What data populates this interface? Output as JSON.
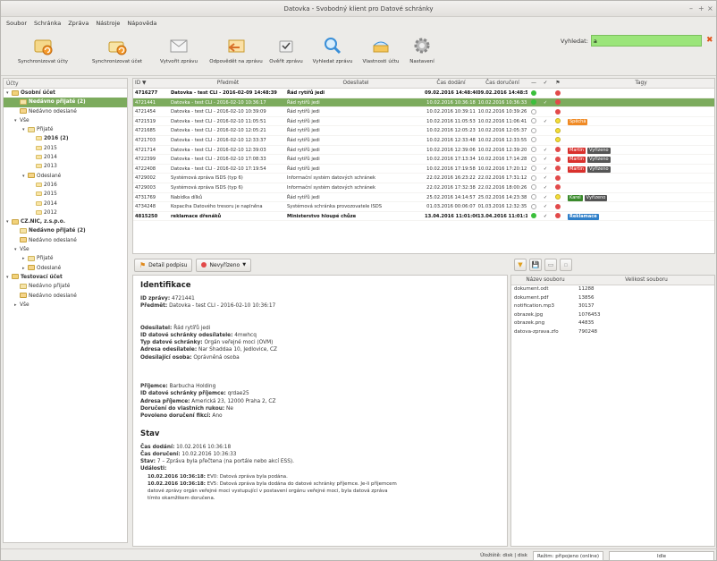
{
  "window": {
    "title": "Datovka - Svobodný klient pro Datové schránky",
    "controls": [
      "–",
      "+",
      "×"
    ]
  },
  "menu": [
    "Soubor",
    "Schránka",
    "Zpráva",
    "Nástroje",
    "Nápověda"
  ],
  "toolbar": {
    "buttons": [
      "Synchronizovat účty",
      "Synchronizovat účet",
      "Vytvořit zprávu",
      "Odpovědět na zprávu",
      "Ověřit zprávu",
      "Vyhledat zprávu",
      "Vlastnosti účtu",
      "Nastavení"
    ],
    "search_label": "Vyhledat:",
    "search_value": "a"
  },
  "colors": {
    "accent_green": "#7cab5d",
    "search_bg": "#9be57a"
  },
  "tree": {
    "header": "Účty",
    "rows": [
      {
        "label": "Osobní účet",
        "level": 0,
        "expander": "▾",
        "icon": "acc",
        "bold": true
      },
      {
        "label": "Nedávno přijaté (2)",
        "level": 1,
        "icon": "inbox",
        "bold": true,
        "selected": true
      },
      {
        "label": "Nedávno odeslané",
        "level": 1,
        "icon": "outbox"
      },
      {
        "label": "Vše",
        "level": 1,
        "expander": "▾"
      },
      {
        "label": "Přijaté",
        "level": 2,
        "expander": "▾",
        "icon": "inbox"
      },
      {
        "label": "2016 (2)",
        "level": 3,
        "icon": "year",
        "bold": true
      },
      {
        "label": "2015",
        "level": 3,
        "icon": "year"
      },
      {
        "label": "2014",
        "level": 3,
        "icon": "year"
      },
      {
        "label": "2013",
        "level": 3,
        "icon": "year"
      },
      {
        "label": "Odeslané",
        "level": 2,
        "expander": "▾",
        "icon": "outbox"
      },
      {
        "label": "2016",
        "level": 3,
        "icon": "year"
      },
      {
        "label": "2015",
        "level": 3,
        "icon": "year"
      },
      {
        "label": "2014",
        "level": 3,
        "icon": "year"
      },
      {
        "label": "2012",
        "level": 3,
        "icon": "year"
      },
      {
        "label": "CZ.NIC, z.s.p.o.",
        "level": 0,
        "expander": "▾",
        "icon": "acc",
        "bold": true
      },
      {
        "label": "Nedávno přijaté (2)",
        "level": 1,
        "icon": "inbox",
        "bold": true
      },
      {
        "label": "Nedávno odeslané",
        "level": 1,
        "icon": "outbox"
      },
      {
        "label": "Vše",
        "level": 1,
        "expander": "▾"
      },
      {
        "label": "Přijaté",
        "level": 2,
        "expander": "▸",
        "icon": "inbox"
      },
      {
        "label": "Odeslané",
        "level": 2,
        "expander": "▸",
        "icon": "outbox"
      },
      {
        "label": "Testovací účet",
        "level": 0,
        "expander": "▾",
        "icon": "acc",
        "bold": true
      },
      {
        "label": "Nedávno přijaté",
        "level": 1,
        "icon": "inbox"
      },
      {
        "label": "Nedávno odeslané",
        "level": 1,
        "icon": "outbox"
      },
      {
        "label": "Vše",
        "level": 1,
        "expander": "▸"
      }
    ]
  },
  "messages": {
    "columns": [
      "ID ▼",
      "Předmět",
      "Odesílatel",
      "Čas dodání",
      "Čas doručení",
      "—",
      "✓",
      "⚑",
      "Tagy"
    ],
    "rows": [
      {
        "id": "4716277",
        "subject": "Datovka - test CLI - 2016-02-09 14:48:39",
        "sender": "Řád rytířů jedi",
        "received": "09.02.2016 14:48:40",
        "delivered": "09.02.2016 14:48:55",
        "f1": "g",
        "f2": "",
        "f3": "r",
        "tags": [],
        "bold": true
      },
      {
        "id": "4721441",
        "subject": "Datovka - test CLI - 2016-02-10 10:36:17",
        "sender": "Řád rytířů jedi",
        "received": "10.02.2016 10:36:18",
        "delivered": "10.02.2016 10:36:33",
        "f1": "g",
        "f2": "✓",
        "f3": "r",
        "tags": [],
        "selected": true
      },
      {
        "id": "4721454",
        "subject": "Datovka - test CLI - 2016-02-10 10:39:09",
        "sender": "Řád rytířů jedi",
        "received": "10.02.2016 10:39:11",
        "delivered": "10.02.2016 10:39:26",
        "f1": "o",
        "f2": "",
        "f3": "r",
        "tags": []
      },
      {
        "id": "4721519",
        "subject": "Datovka - test CLI - 2016-02-10 11:05:51",
        "sender": "Řád rytířů jedi",
        "received": "10.02.2016 11:05:53",
        "delivered": "10.02.2016 11:06:41",
        "f1": "o",
        "f2": "✓",
        "f3": "y",
        "tags": [
          {
            "text": "Spěchá",
            "color": "#f08a24"
          }
        ]
      },
      {
        "id": "4721685",
        "subject": "Datovka - test CLI - 2016-02-10 12:05:21",
        "sender": "Řád rytířů jedi",
        "received": "10.02.2016 12:05:23",
        "delivered": "10.02.2016 12:05:37",
        "f1": "o",
        "f2": "",
        "f3": "y",
        "tags": []
      },
      {
        "id": "4721703",
        "subject": "Datovka - test CLI - 2016-02-10 12:33:37",
        "sender": "Řád rytířů jedi",
        "received": "10.02.2016 12:33:48",
        "delivered": "10.02.2016 12:33:55",
        "f1": "o",
        "f2": "",
        "f3": "y",
        "tags": []
      },
      {
        "id": "4721714",
        "subject": "Datovka - test CLI - 2016-02-10 12:39:03",
        "sender": "Řád rytířů jedi",
        "received": "10.02.2016 12:39:06",
        "delivered": "10.02.2016 12:39:20",
        "f1": "o",
        "f2": "✓",
        "f3": "r",
        "tags": [
          {
            "text": "Martin",
            "color": "#d9302c"
          },
          {
            "text": "Vyřízeno",
            "color": "#555555"
          }
        ]
      },
      {
        "id": "4722399",
        "subject": "Datovka - test CLI - 2016-02-10 17:08:33",
        "sender": "Řád rytířů jedi",
        "received": "10.02.2016 17:13:34",
        "delivered": "10.02.2016 17:14:28",
        "f1": "o",
        "f2": "✓",
        "f3": "r",
        "tags": [
          {
            "text": "Martin",
            "color": "#d9302c"
          },
          {
            "text": "Vyřízeno",
            "color": "#555555"
          }
        ]
      },
      {
        "id": "4722408",
        "subject": "Datovka - test CLI - 2016-02-10 17:19:54",
        "sender": "Řád rytířů jedi",
        "received": "10.02.2016 17:19:58",
        "delivered": "10.02.2016 17:20:12",
        "f1": "o",
        "f2": "✓",
        "f3": "r",
        "tags": [
          {
            "text": "Martin",
            "color": "#d9302c"
          },
          {
            "text": "Vyřízeno",
            "color": "#555555"
          }
        ]
      },
      {
        "id": "4729002",
        "subject": "Systémová zpráva ISDS (typ 6)",
        "sender": "Informační systém datových schránek",
        "received": "22.02.2016 16:23:22",
        "delivered": "22.02.2016 17:31:12",
        "f1": "o",
        "f2": "✓",
        "f3": "r",
        "tags": []
      },
      {
        "id": "4729003",
        "subject": "Systémová zpráva ISDS (typ 6)",
        "sender": "Informační systém datových schránek",
        "received": "22.02.2016 17:32:38",
        "delivered": "22.02.2016 18:00:26",
        "f1": "o",
        "f2": "✓",
        "f3": "r",
        "tags": []
      },
      {
        "id": "4731769",
        "subject": "Nabídka dílků",
        "sender": "Řád rytířů jedi",
        "received": "25.02.2016 14:14:57",
        "delivered": "25.02.2016 14:23:38",
        "f1": "o",
        "f2": "✓",
        "f3": "y",
        "tags": [
          {
            "text": "Karel",
            "color": "#3a8a2c"
          },
          {
            "text": "Vyřízeno",
            "color": "#555555"
          }
        ]
      },
      {
        "id": "4734248",
        "subject": "Kopaciha Datového tresoru je naplněna",
        "sender": "Systémová schránka provozovatele ISDS",
        "received": "01.03.2016 00:06:07",
        "delivered": "01.03.2016 12:32:35",
        "f1": "o",
        "f2": "✓",
        "f3": "r",
        "tags": []
      },
      {
        "id": "4815250",
        "subject": "reklamace dřenáků",
        "sender": "Ministerstvo hloupé chůze",
        "received": "13.04.2016 11:01:06",
        "delivered": "13.04.2016 11:01:13",
        "f1": "g",
        "f2": "✓",
        "f3": "r",
        "tags": [
          {
            "text": "Reklamace",
            "color": "#2f7fc9"
          }
        ],
        "bold": true
      }
    ]
  },
  "detail_buttons": {
    "signature": "Detail podpisu",
    "state": "Nevyřízeno"
  },
  "detail": {
    "ident_title": "Identifikace",
    "msg_id": {
      "k": "ID zprávy:",
      "v": "4721441"
    },
    "subject": {
      "k": "Předmět:",
      "v": "Datovka - test CLI - 2016-02-10 10:36:17"
    },
    "sender": {
      "k": "Odesílatel:",
      "v": "Řád rytířů jedi"
    },
    "sender_box": {
      "k": "ID datové schránky odesílatele:",
      "v": "4mwhcq"
    },
    "box_type": {
      "k": "Typ datové schránky:",
      "v": "Orgán veřejné moci (OVM)"
    },
    "sender_addr": {
      "k": "Adresa odesílatele:",
      "v": "Nar Shaddaa 10, Jedlovice, CZ"
    },
    "sender_person": {
      "k": "Odesílající osoba:",
      "v": "Oprávněná osoba"
    },
    "recipient": {
      "k": "Příjemce:",
      "v": "Barbucha Holding"
    },
    "recipient_box": {
      "k": "ID datové schránky příjemce:",
      "v": "qrdae25"
    },
    "recipient_addr": {
      "k": "Adresa příjemce:",
      "v": "Americká 23, 12000 Praha 2, CZ"
    },
    "personal": {
      "k": "Doručení do vlastních rukou:",
      "v": "Ne"
    },
    "fiction": {
      "k": "Povoleno doručení fikcí:",
      "v": "Ano"
    },
    "state_title": "Stav",
    "received": {
      "k": "Čas dodání:",
      "v": "10.02.2016 10:36:18"
    },
    "delivered": {
      "k": "Čas doručení:",
      "v": "10.02.2016 10:36:33"
    },
    "status": {
      "k": "Stav:",
      "v": "7 – Zpráva byla přečtena (na portále nebo akcí ESS)."
    },
    "events_label": "Události:",
    "events": [
      {
        "t": "10.02.2016 10:36:18:",
        "d": "EV0: Datová zpráva byla podána."
      },
      {
        "t": "10.02.2016 10:36:18:",
        "d": "EV5: Datová zpráva byla dodána do datové schránky příjemce. Je-li příjemcem"
      },
      {
        "t": "",
        "d": "datové zprávy orgán veřejné moci vystupující v postavení orgánu veřejné moci, byla datová zpráva"
      },
      {
        "t": "",
        "d": "tímto okamžikem doručena."
      }
    ]
  },
  "attachments": {
    "columns": [
      "Název souboru",
      "Velikost souboru"
    ],
    "rows": [
      {
        "name": "dokument.odt",
        "size": "11288"
      },
      {
        "name": "dokument.pdf",
        "size": "13856"
      },
      {
        "name": "notification.mp3",
        "size": "30137"
      },
      {
        "name": "obrazek.jpg",
        "size": "1076453"
      },
      {
        "name": "obrazek.png",
        "size": "44835"
      },
      {
        "name": "datova-zprava.zfo",
        "size": "790248"
      }
    ]
  },
  "status": {
    "storage": "Úložiště: disk | disk",
    "mode": "Režim: připojeno (online)",
    "idle": "Idle"
  }
}
